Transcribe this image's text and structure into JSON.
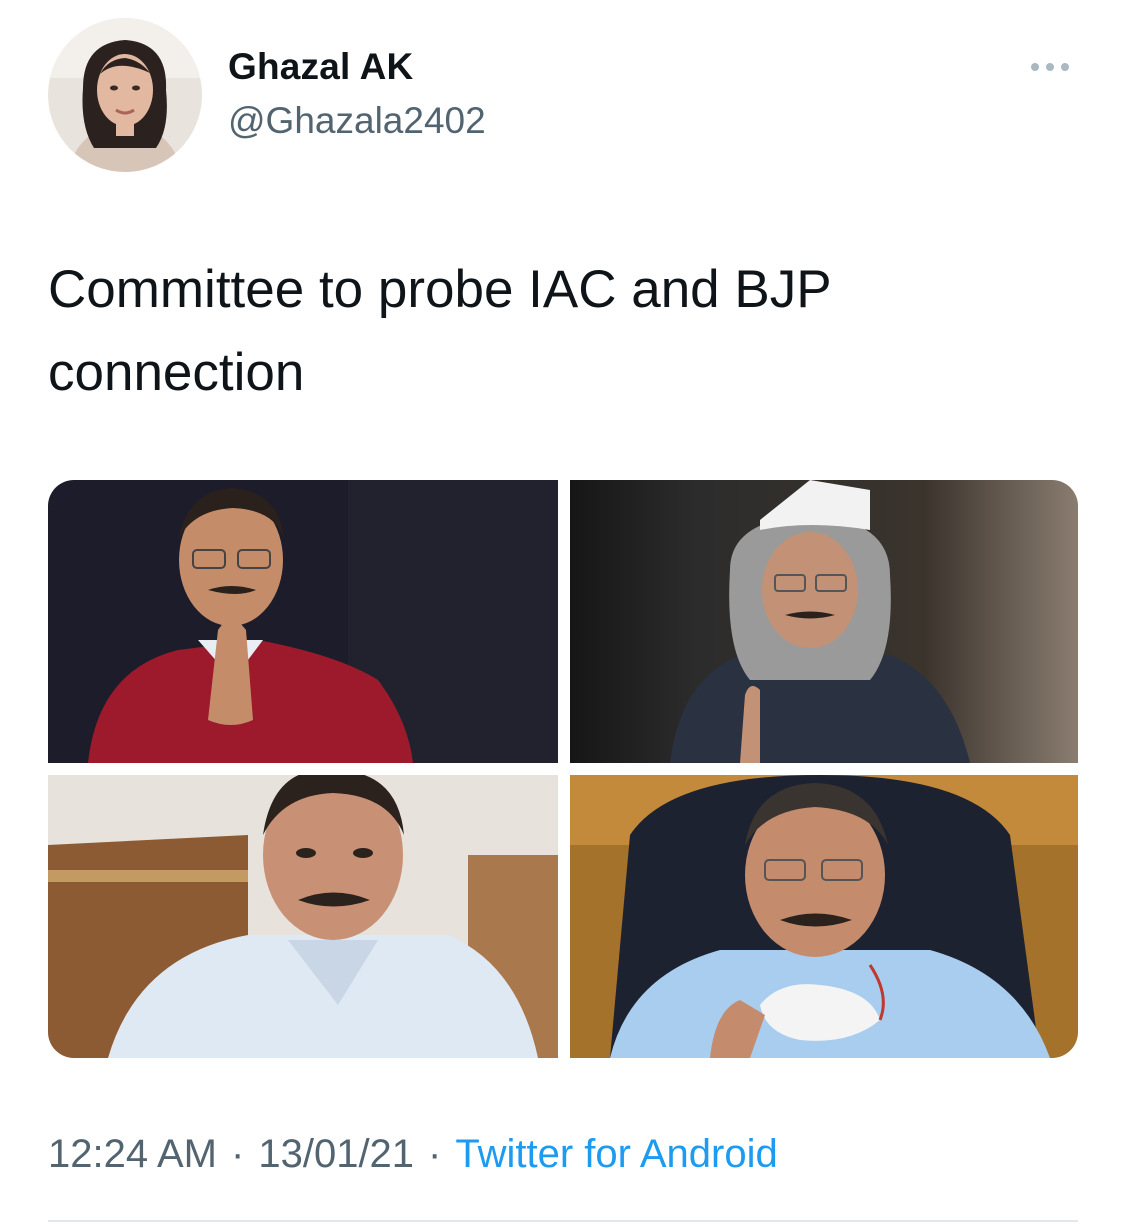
{
  "author": {
    "display_name": "Ghazal AK",
    "handle": "@Ghazala2402"
  },
  "tweet": {
    "text": "Committee to probe IAC and BJP\nconnection",
    "time": "12:24 AM",
    "date": "13/01/21",
    "separator": "·",
    "source": "Twitter for Android"
  },
  "colors": {
    "text": "#0f1419",
    "secondary": "#536471",
    "link": "#1d9bf0"
  },
  "media": [
    {
      "description": "man in red sweater with folded hands on dark background"
    },
    {
      "description": "man in white cap and grey scarf pointing finger"
    },
    {
      "description": "man in light blue shirt seated on wooden chair"
    },
    {
      "description": "man in blue shirt holding white mask"
    }
  ]
}
